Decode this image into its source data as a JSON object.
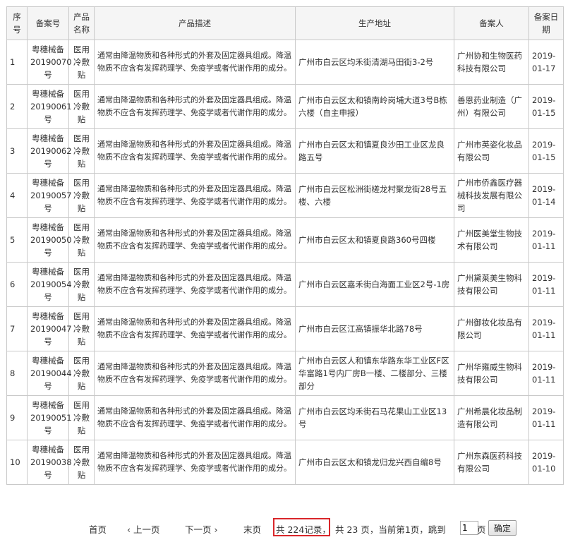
{
  "table": {
    "headers": [
      "序号",
      "备案号",
      "产品名称",
      "产品描述",
      "生产地址",
      "备案人",
      "备案日期"
    ],
    "rows": [
      {
        "idx": "1",
        "reg": "粤穗械备20190070号",
        "name": "医用冷敷贴",
        "desc": "通常由降温物质和各种形式的外套及固定器具组成。降温物质不应含有发挥药理学、免疫学或者代谢作用的成分。",
        "addr": "广州市白云区均禾街清湖马田街3-2号",
        "filer": "广州协和生物医药科技有限公司",
        "date": "2019-01-17"
      },
      {
        "idx": "2",
        "reg": "粤穗械备20190061号",
        "name": "医用冷敷贴",
        "desc": "通常由降温物质和各种形式的外套及固定器具组成。降温物质不应含有发挥药理学、免疫学或者代谢作用的成分。",
        "addr": "广州市白云区太和镇南岭岗埔大道3号B栋六楼（自主申报）",
        "filer": "善恩药业制造（广州）有限公司",
        "date": "2019-01-15"
      },
      {
        "idx": "3",
        "reg": "粤穗械备20190062号",
        "name": "医用冷敷贴",
        "desc": "通常由降温物质和各种形式的外套及固定器具组成。降温物质不应含有发挥药理学、免疫学或者代谢作用的成分。",
        "addr": "广州市白云区太和镇夏良沙田工业区龙良路五号",
        "filer": "广州市英姿化妆品有限公司",
        "date": "2019-01-15"
      },
      {
        "idx": "4",
        "reg": "粤穗械备20190057号",
        "name": "医用冷敷贴",
        "desc": "通常由降温物质和各种形式的外套及固定器具组成。降温物质不应含有发挥药理学、免疫学或者代谢作用的成分。",
        "addr": "广州市白云区松洲街槎龙村聚龙街28号五楼、六楼",
        "filer": "广州市侨鑫医疗器械科技发展有限公司",
        "date": "2019-01-14"
      },
      {
        "idx": "5",
        "reg": "粤穗械备20190050号",
        "name": "医用冷敷贴",
        "desc": "通常由降温物质和各种形式的外套及固定器具组成。降温物质不应含有发挥药理学、免疫学或者代谢作用的成分。",
        "addr": "广州市白云区太和镇夏良路360号四楼",
        "filer": "广州医美堂生物技术有限公司",
        "date": "2019-01-11"
      },
      {
        "idx": "6",
        "reg": "粤穗械备20190054号",
        "name": "医用冷敷贴",
        "desc": "通常由降温物质和各种形式的外套及固定器具组成。降温物质不应含有发挥药理学、免疫学或者代谢作用的成分。",
        "addr": "广州市白云区嘉禾街白海面工业区2号-1房",
        "filer": "广州黛莱美生物科技有限公司",
        "date": "2019-01-11"
      },
      {
        "idx": "7",
        "reg": "粤穗械备20190047号",
        "name": "医用冷敷贴",
        "desc": "通常由降温物质和各种形式的外套及固定器具组成。降温物质不应含有发挥药理学、免疫学或者代谢作用的成分。",
        "addr": "广州市白云区江高镇振华北路78号",
        "filer": "广州御妆化妆品有限公司",
        "date": "2019-01-11"
      },
      {
        "idx": "8",
        "reg": "粤穗械备20190044号",
        "name": "医用冷敷贴",
        "desc": "通常由降温物质和各种形式的外套及固定器具组成。降温物质不应含有发挥药理学、免疫学或者代谢作用的成分。",
        "addr": "广州市白云区人和镇东华路东华工业区F区华富路1号内厂房B一楼、二楼部分、三楼部分",
        "filer": "广州华雍威生物科技有限公司",
        "date": "2019-01-11"
      },
      {
        "idx": "9",
        "reg": "粤穗械备20190051号",
        "name": "医用冷敷贴",
        "desc": "通常由降温物质和各种形式的外套及固定器具组成。降温物质不应含有发挥药理学、免疫学或者代谢作用的成分。",
        "addr": "广州市白云区均禾街石马花果山工业区13号",
        "filer": "广州希晨化妆品制造有限公司",
        "date": "2019-01-11"
      },
      {
        "idx": "10",
        "reg": "粤穗械备20190038号",
        "name": "医用冷敷贴",
        "desc": "通常由降温物质和各种形式的外套及固定器具组成。降温物质不应含有发挥药理学、免疫学或者代谢作用的成分。",
        "addr": "广州市白云区太和镇龙归龙兴西自编8号",
        "filer": "广州东森医药科技有限公司",
        "date": "2019-01-10"
      }
    ]
  },
  "pager": {
    "first": "首页",
    "prev": "‹ 上一页",
    "next": "下一页 ›",
    "last": "末页",
    "total_records": "共 224记录，",
    "total_pages": "共 23 页，当前第1页，跳到",
    "jump_value": "1",
    "page_unit": "页",
    "confirm": "确定",
    "highlight_color": "#d9262a"
  }
}
